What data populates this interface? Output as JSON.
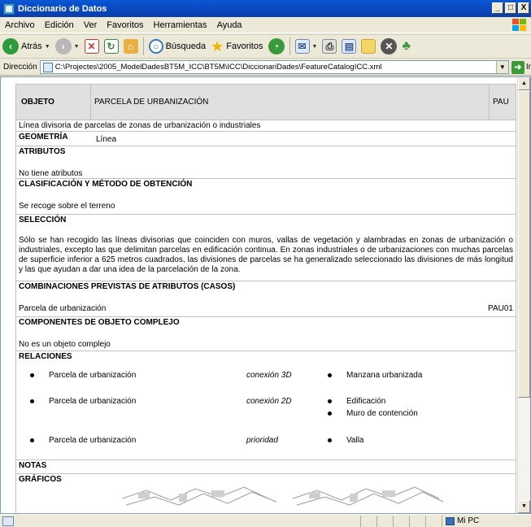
{
  "window": {
    "title": "Diccionario de Datos",
    "controls": [
      "_",
      "□",
      "X"
    ]
  },
  "menu": {
    "items": [
      "Archivo",
      "Edición",
      "Ver",
      "Favoritos",
      "Herramientas",
      "Ayuda"
    ]
  },
  "toolbar": {
    "back_label": "Atrás",
    "search_label": "Búsqueda",
    "favorites_label": "Favoritos"
  },
  "address": {
    "label": "Dirección",
    "value": "C:\\Projectes\\2005_ModelDadesBT5M_ICC\\BT5M\\ICC\\DiccionariDades\\FeatureCatalogICC.xml",
    "go_label": "Ir"
  },
  "doc": {
    "objeto_label": "OBJETO",
    "objeto_name": "PARCELA DE URBANIZACIÓN",
    "objeto_code": "PAU",
    "description": "Línea divisoria de parcelas de zonas de urbanización o industriales",
    "geometria_label": "GEOMETRÍA",
    "geometria_value": "Línea",
    "atributos_label": "ATRIBUTOS",
    "atributos_value": "No tiene atributos",
    "clasificacion_label": "CLASIFICACIÓN Y MÉTODO DE OBTENCIÓN",
    "clasificacion_value": "Se recoge sobre el terreno",
    "seleccion_label": "SELECCIÓN",
    "seleccion_value": "Sólo se han recogido las líneas divisorias que coinciden con muros, vallas de vegetación y alambradas en zonas de urbanización o industriales, excepto las que delimitan parcelas en edificación continua. En zonas industriales o de urbanizaciones con muchas parcelas de superficie inferior a 625 metros cuadrados, las divisiones de parcelas se ha generalizado seleccionado las divisiones de más longitud y las que ayudan a dar una idea de la parcelación de la zona.",
    "combinaciones_label": "COMBINACIONES PREVISTAS DE ATRIBUTOS (CASOS)",
    "combinaciones_name": "Parcela de urbanización",
    "combinaciones_code": "PAU01",
    "componentes_label": "COMPONENTES DE OBJETO COMPLEJO",
    "componentes_value": "No es un objeto complejo",
    "relaciones_label": "RELACIONES",
    "relaciones": [
      {
        "from": "Parcela de urbanización",
        "type": "conexión 3D",
        "to": [
          "Manzana urbanizada"
        ]
      },
      {
        "from": "Parcela de urbanización",
        "type": "conexión 2D",
        "to": [
          "Edificación",
          "Muro de contención"
        ]
      },
      {
        "from": "Parcela de urbanización",
        "type": "prioridad",
        "to": [
          "Valla"
        ]
      }
    ],
    "notas_label": "NOTAS",
    "graficos_label": "GRÁFICOS"
  },
  "status": {
    "zone": "Mi PC"
  }
}
